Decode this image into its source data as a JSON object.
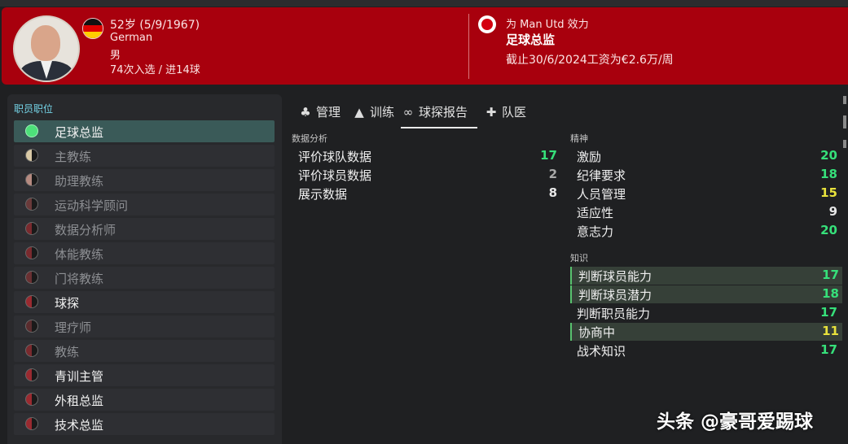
{
  "header": {
    "age_dob": "52岁 (5/9/1967)",
    "nationality": "German",
    "gender": "男",
    "caps": "74次入选 / 进14球",
    "club_line": "为 Man Utd 效力",
    "role_title": "足球总监",
    "contract": "截止30/6/2024工资为€2.6万/周"
  },
  "roles_panel": {
    "title": "职员职位",
    "items": [
      {
        "label": "足球总监",
        "state": "active",
        "fill": "#4de07a"
      },
      {
        "label": "主教练",
        "state": "dim",
        "fill": "#d9c9a6"
      },
      {
        "label": "助理教练",
        "state": "dim",
        "fill": "#b58a80"
      },
      {
        "label": "运动科学顾问",
        "state": "dim",
        "fill": "#6a3a3a"
      },
      {
        "label": "数据分析师",
        "state": "dim",
        "fill": "#7a2a2e"
      },
      {
        "label": "体能教练",
        "state": "dim",
        "fill": "#7a2a2e"
      },
      {
        "label": "门将教练",
        "state": "dim",
        "fill": "#6a3032"
      },
      {
        "label": "球探",
        "state": "bright",
        "fill": "#9a2a30"
      },
      {
        "label": "理疗师",
        "state": "dim",
        "fill": "#5a2c2e"
      },
      {
        "label": "教练",
        "state": "dim",
        "fill": "#7a2a2e"
      },
      {
        "label": "青训主管",
        "state": "bright",
        "fill": "#9a2a30"
      },
      {
        "label": "外租总监",
        "state": "bright",
        "fill": "#9a2a30"
      },
      {
        "label": "技术总监",
        "state": "bright",
        "fill": "#9a2a30"
      }
    ]
  },
  "tabs": [
    {
      "label": "管理",
      "icon": "people-icon",
      "glyph": "♣"
    },
    {
      "label": "训练",
      "icon": "cone-icon",
      "glyph": "▲"
    },
    {
      "label": "球探报告",
      "icon": "binoculars-icon",
      "glyph": "∞",
      "active": true
    },
    {
      "label": "队医",
      "icon": "medkit-icon",
      "glyph": "✚"
    }
  ],
  "data_analysis": {
    "title": "数据分析",
    "items": [
      {
        "label": "评价球队数据",
        "value": "17",
        "color": "g"
      },
      {
        "label": "评价球员数据",
        "value": "2",
        "color": "gr"
      },
      {
        "label": "展示数据",
        "value": "8",
        "color": "w"
      }
    ]
  },
  "mental": {
    "title": "精神",
    "items": [
      {
        "label": "激励",
        "value": "20",
        "color": "g"
      },
      {
        "label": "纪律要求",
        "value": "18",
        "color": "g"
      },
      {
        "label": "人员管理",
        "value": "15",
        "color": "y"
      },
      {
        "label": "适应性",
        "value": "9",
        "color": "w"
      },
      {
        "label": "意志力",
        "value": "20",
        "color": "g"
      }
    ]
  },
  "knowledge": {
    "title": "知识",
    "items": [
      {
        "label": "判断球员能力",
        "value": "17",
        "color": "g",
        "highlight": true
      },
      {
        "label": "判断球员潜力",
        "value": "18",
        "color": "g",
        "highlight": true
      },
      {
        "label": "判断职员能力",
        "value": "17",
        "color": "g",
        "highlight": false
      },
      {
        "label": "协商中",
        "value": "11",
        "color": "y",
        "highlight": true
      },
      {
        "label": "战术知识",
        "value": "17",
        "color": "g",
        "highlight": false
      }
    ]
  },
  "watermark": "头条 @豪哥爱踢球"
}
